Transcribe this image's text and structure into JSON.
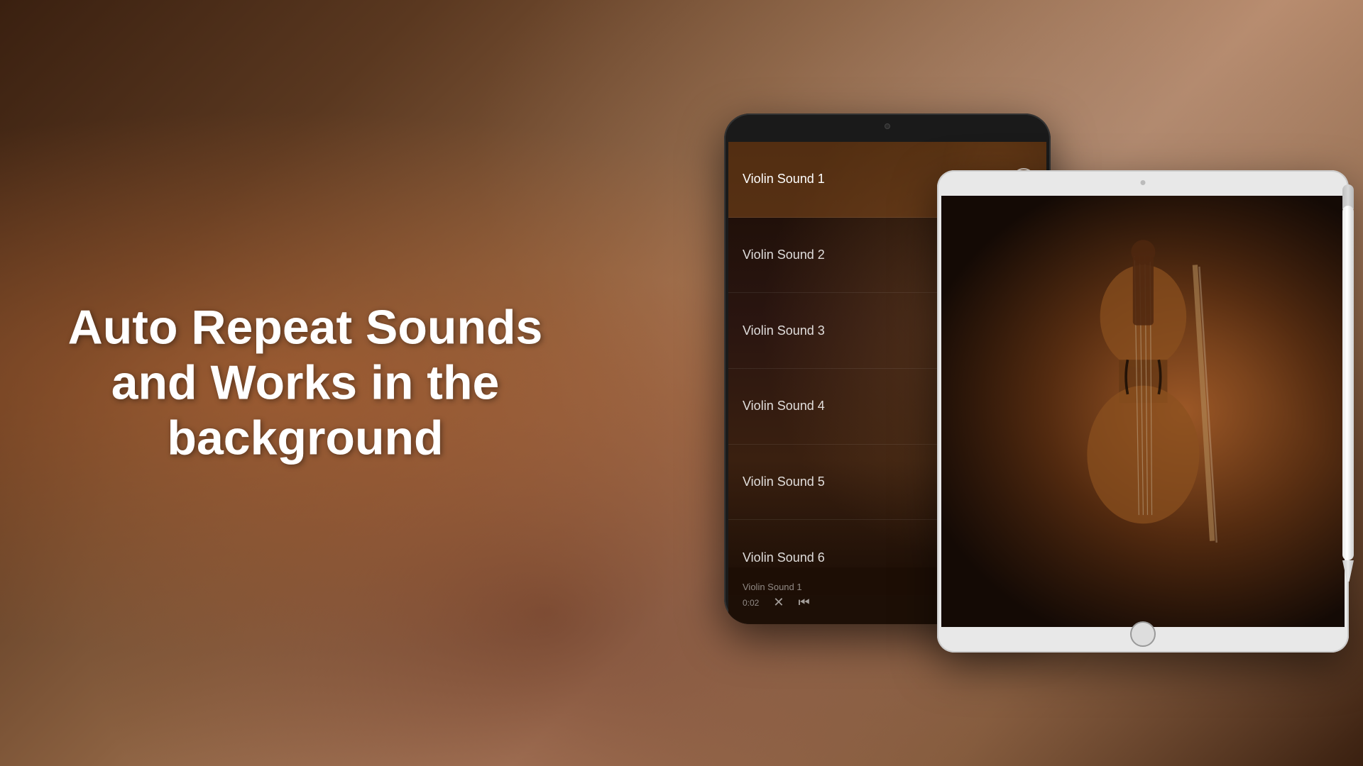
{
  "background": {
    "colors": [
      "#3a2010",
      "#8a6040",
      "#c09070"
    ]
  },
  "left_text": {
    "line1": "Auto Repeat Sounds",
    "line2": "and Works in the",
    "line3": "background"
  },
  "dark_tablet": {
    "songs": [
      {
        "id": 1,
        "title": "Violin Sound 1",
        "active": true
      },
      {
        "id": 2,
        "title": "Violin Sound 2",
        "active": false
      },
      {
        "id": 3,
        "title": "Violin Sound 3",
        "active": false
      },
      {
        "id": 4,
        "title": "Violin Sound 4",
        "active": false
      },
      {
        "id": 5,
        "title": "Violin Sound 5",
        "active": false
      },
      {
        "id": 6,
        "title": "Violin Sound 6",
        "active": false
      }
    ],
    "now_playing": "Violin Sound 1",
    "time": "0:02"
  },
  "white_tablet": {
    "content": "violin-image"
  },
  "controls": {
    "shuffle_icon": "✕",
    "back_icon": "⏮"
  }
}
